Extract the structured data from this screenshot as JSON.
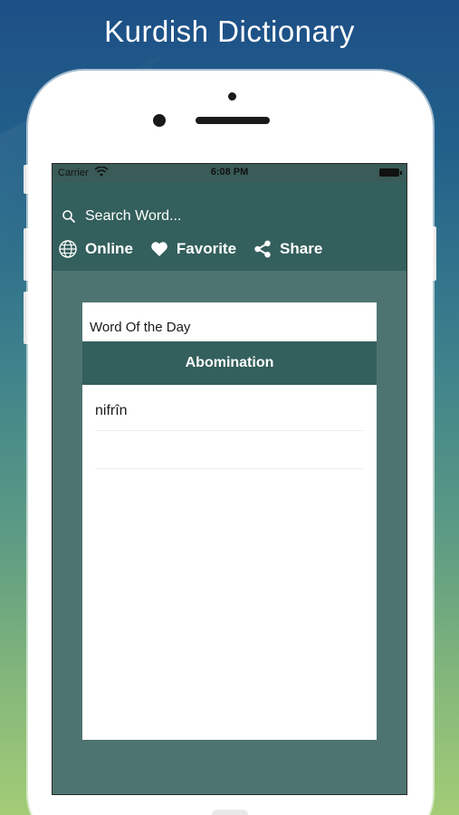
{
  "promo": {
    "title": "Kurdish Dictionary"
  },
  "status_bar": {
    "carrier": "Carrier",
    "time": "6:08 PM"
  },
  "search": {
    "placeholder": "Search Word..."
  },
  "actions": [
    {
      "label": "Online",
      "icon": "globe-icon"
    },
    {
      "label": "Favorite",
      "icon": "heart-icon"
    },
    {
      "label": "Share",
      "icon": "share-icon"
    }
  ],
  "word_of_day": {
    "heading": "Word Of the Day",
    "word": "Abomination",
    "translation": "nifrîn"
  },
  "colors": {
    "header": "#335f5c",
    "screen_bg": "#4e7471",
    "card": "#ffffff",
    "text_light": "#ffffff"
  }
}
